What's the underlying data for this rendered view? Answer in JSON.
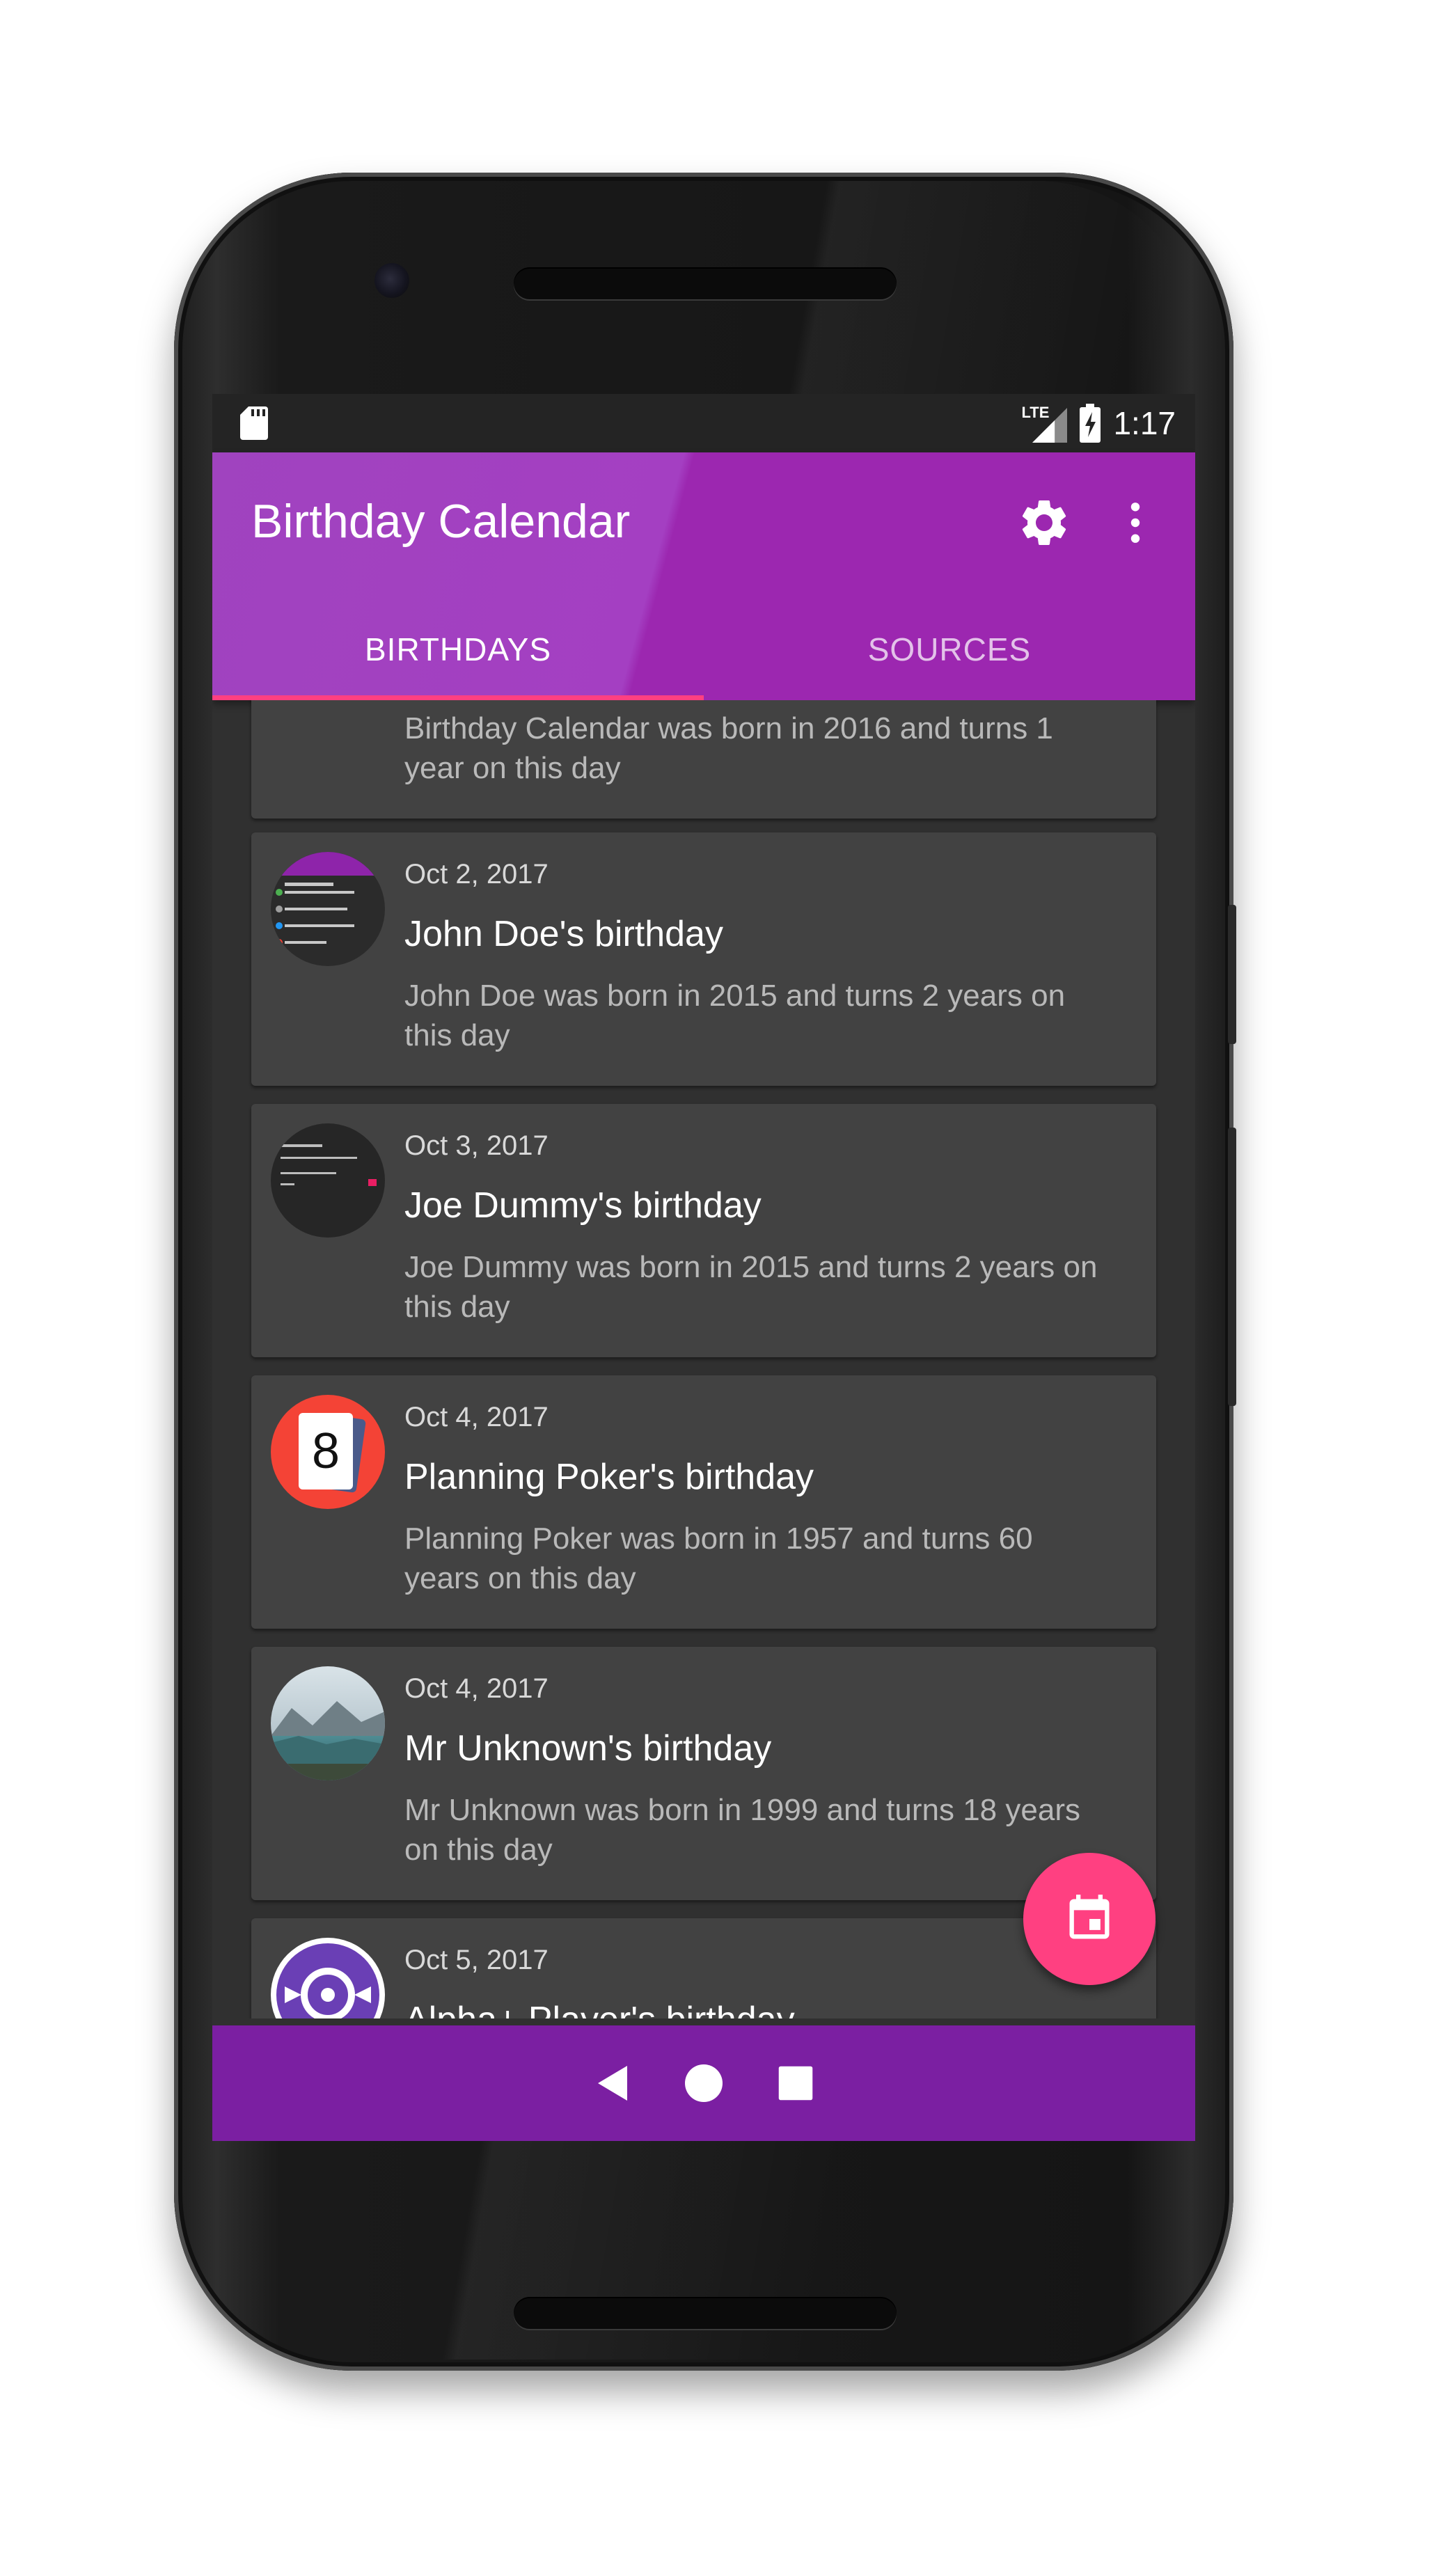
{
  "status_bar": {
    "network_label": "LTE",
    "time": "1:17"
  },
  "app_bar": {
    "title": "Birthday Calendar",
    "settings_icon": "gear-icon",
    "overflow_icon": "more-vert-icon",
    "accent_color": "#9c27b0"
  },
  "tabs": [
    {
      "label": "BIRTHDAYS",
      "selected": true
    },
    {
      "label": "SOURCES",
      "selected": false
    }
  ],
  "list": {
    "items": [
      {
        "date": "",
        "title": "",
        "description": "Birthday Calendar was born in 2016 and turns 1 year on this day"
      },
      {
        "date": "Oct 2, 2017",
        "title": "John Doe's birthday",
        "description": "John Doe was born in 2015 and turns 2 years on this day"
      },
      {
        "date": "Oct 3, 2017",
        "title": "Joe Dummy's birthday",
        "description": "Joe Dummy was born in 2015 and turns 2 years on this day"
      },
      {
        "date": "Oct 4, 2017",
        "title": "Planning Poker's birthday",
        "description": "Planning Poker was born in 1957 and turns 60 years on this day",
        "avatar_text": "8"
      },
      {
        "date": "Oct 4, 2017",
        "title": "Mr Unknown's birthday",
        "description": "Mr Unknown was born in 1999 and turns 18 years on this day"
      },
      {
        "date": "Oct 5, 2017",
        "title": "Alpha+ Player's birthday",
        "description": ""
      }
    ]
  },
  "fab": {
    "icon": "calendar-icon",
    "color": "#ff4081"
  },
  "nav_bar": {
    "back_icon": "back-triangle-icon",
    "home_icon": "home-circle-icon",
    "recents_icon": "recents-square-icon",
    "color": "#7b1fa2"
  }
}
